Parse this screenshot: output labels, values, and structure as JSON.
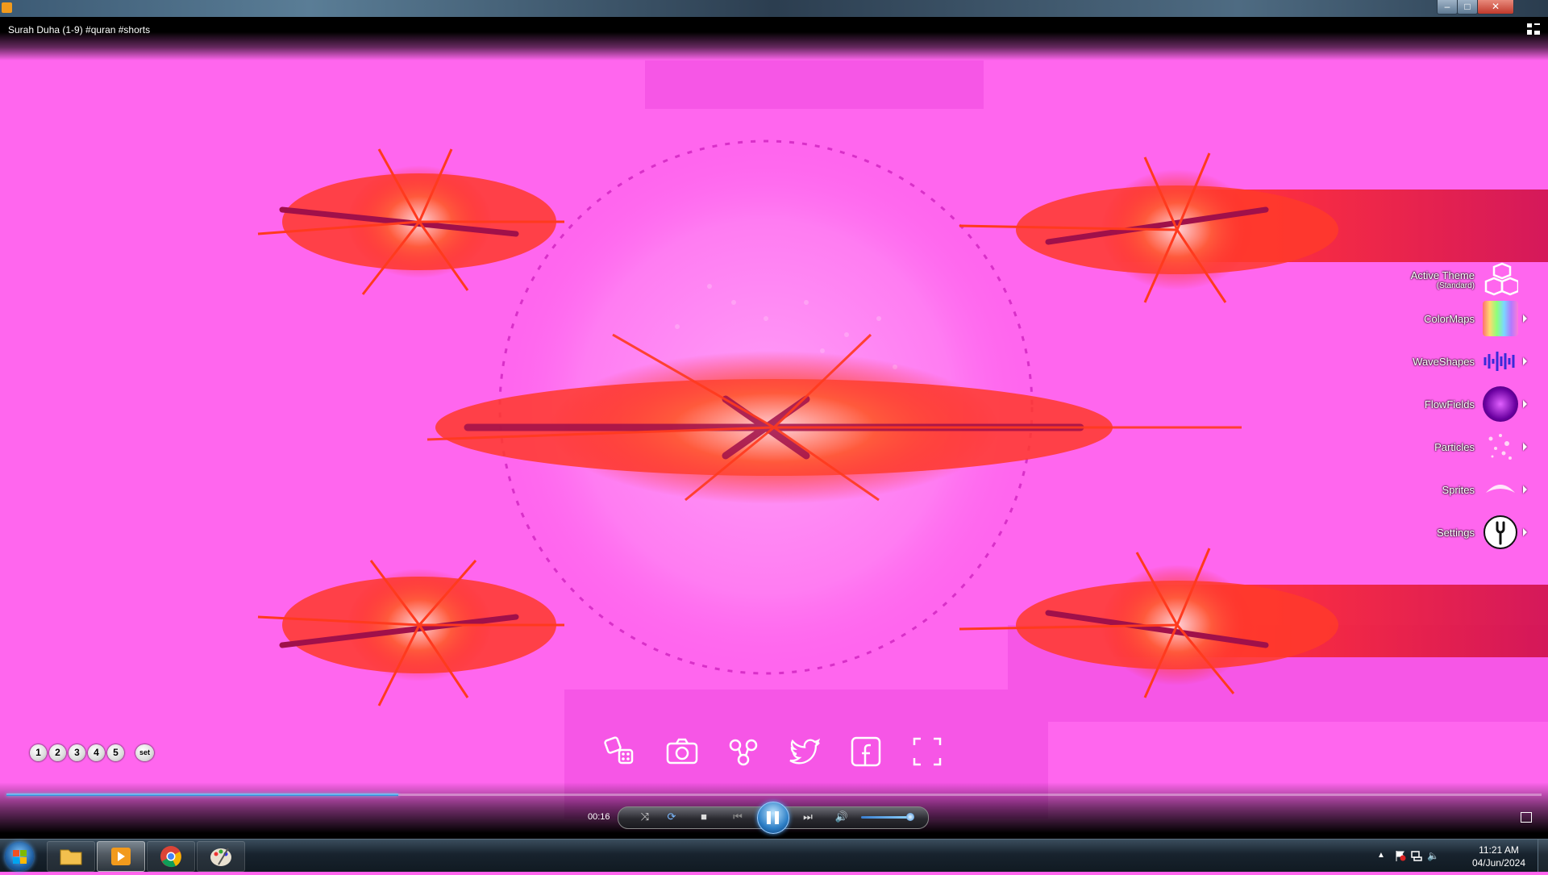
{
  "window": {
    "title": "Surah Duha (1-9) #quran #shorts",
    "controls": {
      "minimize": "–",
      "maximize": "□",
      "close": "✕"
    }
  },
  "visualizer_menu": {
    "active_theme": {
      "label": "Active Theme",
      "value": "(Standard)",
      "icon": "cube-icon"
    },
    "items": [
      {
        "label": "ColorMaps",
        "icon": "colormap-icon"
      },
      {
        "label": "WaveShapes",
        "icon": "waveshape-icon"
      },
      {
        "label": "FlowFields",
        "icon": "flowfield-icon"
      },
      {
        "label": "Particles",
        "icon": "particles-icon"
      },
      {
        "label": "Sprites",
        "icon": "sprite-icon"
      },
      {
        "label": "Settings",
        "icon": "wrench-icon"
      }
    ]
  },
  "presets": {
    "buttons": [
      "1",
      "2",
      "3",
      "4",
      "5"
    ],
    "set_label": "set"
  },
  "actions": [
    {
      "name": "randomize",
      "icon": "dice-icon"
    },
    {
      "name": "screenshot",
      "icon": "camera-icon"
    },
    {
      "name": "share",
      "icon": "share-icon"
    },
    {
      "name": "twitter",
      "icon": "twitter-icon"
    },
    {
      "name": "facebook",
      "icon": "facebook-icon"
    },
    {
      "name": "fullscreen",
      "icon": "fullscreen-icon"
    }
  ],
  "player": {
    "elapsed": "00:16",
    "progress": 0.255,
    "volume": 0.9,
    "state": "playing",
    "accent": "#2d7fc7"
  },
  "taskbar": {
    "apps": [
      {
        "name": "explorer",
        "icon": "folder-icon"
      },
      {
        "name": "media-player",
        "icon": "media-player-icon",
        "active": true
      },
      {
        "name": "chrome",
        "icon": "chrome-icon"
      },
      {
        "name": "paint",
        "icon": "paint-icon"
      }
    ],
    "time": "11:21 AM",
    "date": "04/Jun/2024"
  },
  "colors": {
    "background": "#ff66ee",
    "burst_red": "#ff2a2a",
    "burst_dark": "#c0124a"
  }
}
